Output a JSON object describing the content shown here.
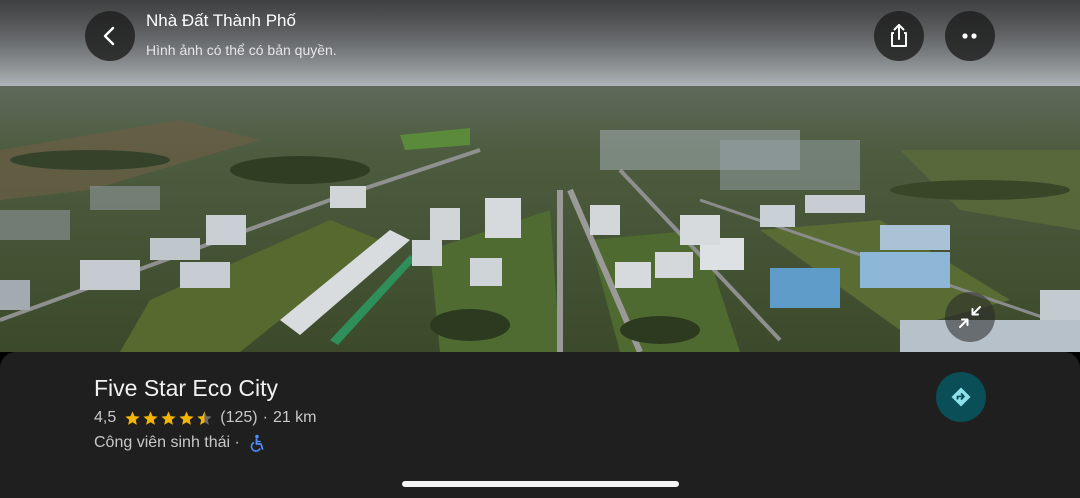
{
  "header": {
    "title": "Nhà Đất Thành Phố",
    "subtitle": "Hình ảnh có thể có bản quyền."
  },
  "icons": {
    "back": "chevron-left-icon",
    "share": "share-icon",
    "more": "more-icon",
    "collapse": "collapse-icon",
    "directions": "directions-icon",
    "accessible": "wheelchair-icon"
  },
  "place": {
    "name": "Five Star Eco City",
    "rating": "4,5",
    "rating_value": 4.5,
    "reviews": "(125)",
    "separator": "·",
    "distance": "21 km",
    "category": "Công viên sinh thái ·"
  },
  "colors": {
    "star": "#f4b400",
    "directions_bg": "#0a4e58",
    "sheet_bg": "#1f1f1f",
    "accessible": "#4d8bf5"
  }
}
